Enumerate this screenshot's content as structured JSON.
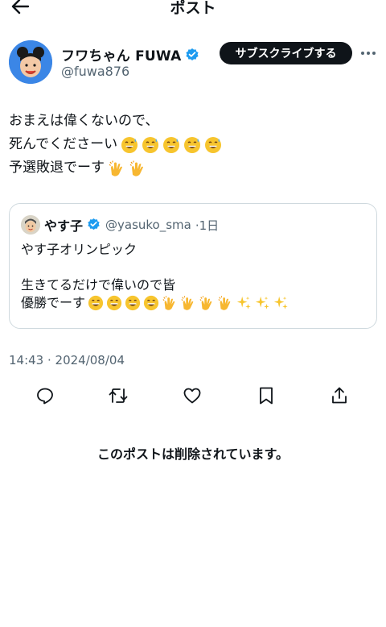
{
  "header": {
    "title": "ポスト"
  },
  "author": {
    "name": "フワちゃん FUWA",
    "handle": "@fuwa876",
    "subscribe_label": "サブスクライブする"
  },
  "tweet": {
    "lines": [
      "おまえは偉くないので、",
      "死んでくださーい",
      "予選敗退でーす"
    ]
  },
  "quote": {
    "name": "やす子",
    "handle": "@yasuko_sma",
    "age": "·1日",
    "lines": [
      "やす子オリンピック",
      "",
      "生きてるだけで偉いので皆",
      "優勝でーす"
    ]
  },
  "timestamp": "14:43 · 2024/08/04",
  "deleted_notice": "このポストは削除されています。",
  "colors": {
    "accent": "#1d9bf0",
    "text": "#0f1419",
    "muted": "#536471",
    "border": "#cfd9de"
  }
}
